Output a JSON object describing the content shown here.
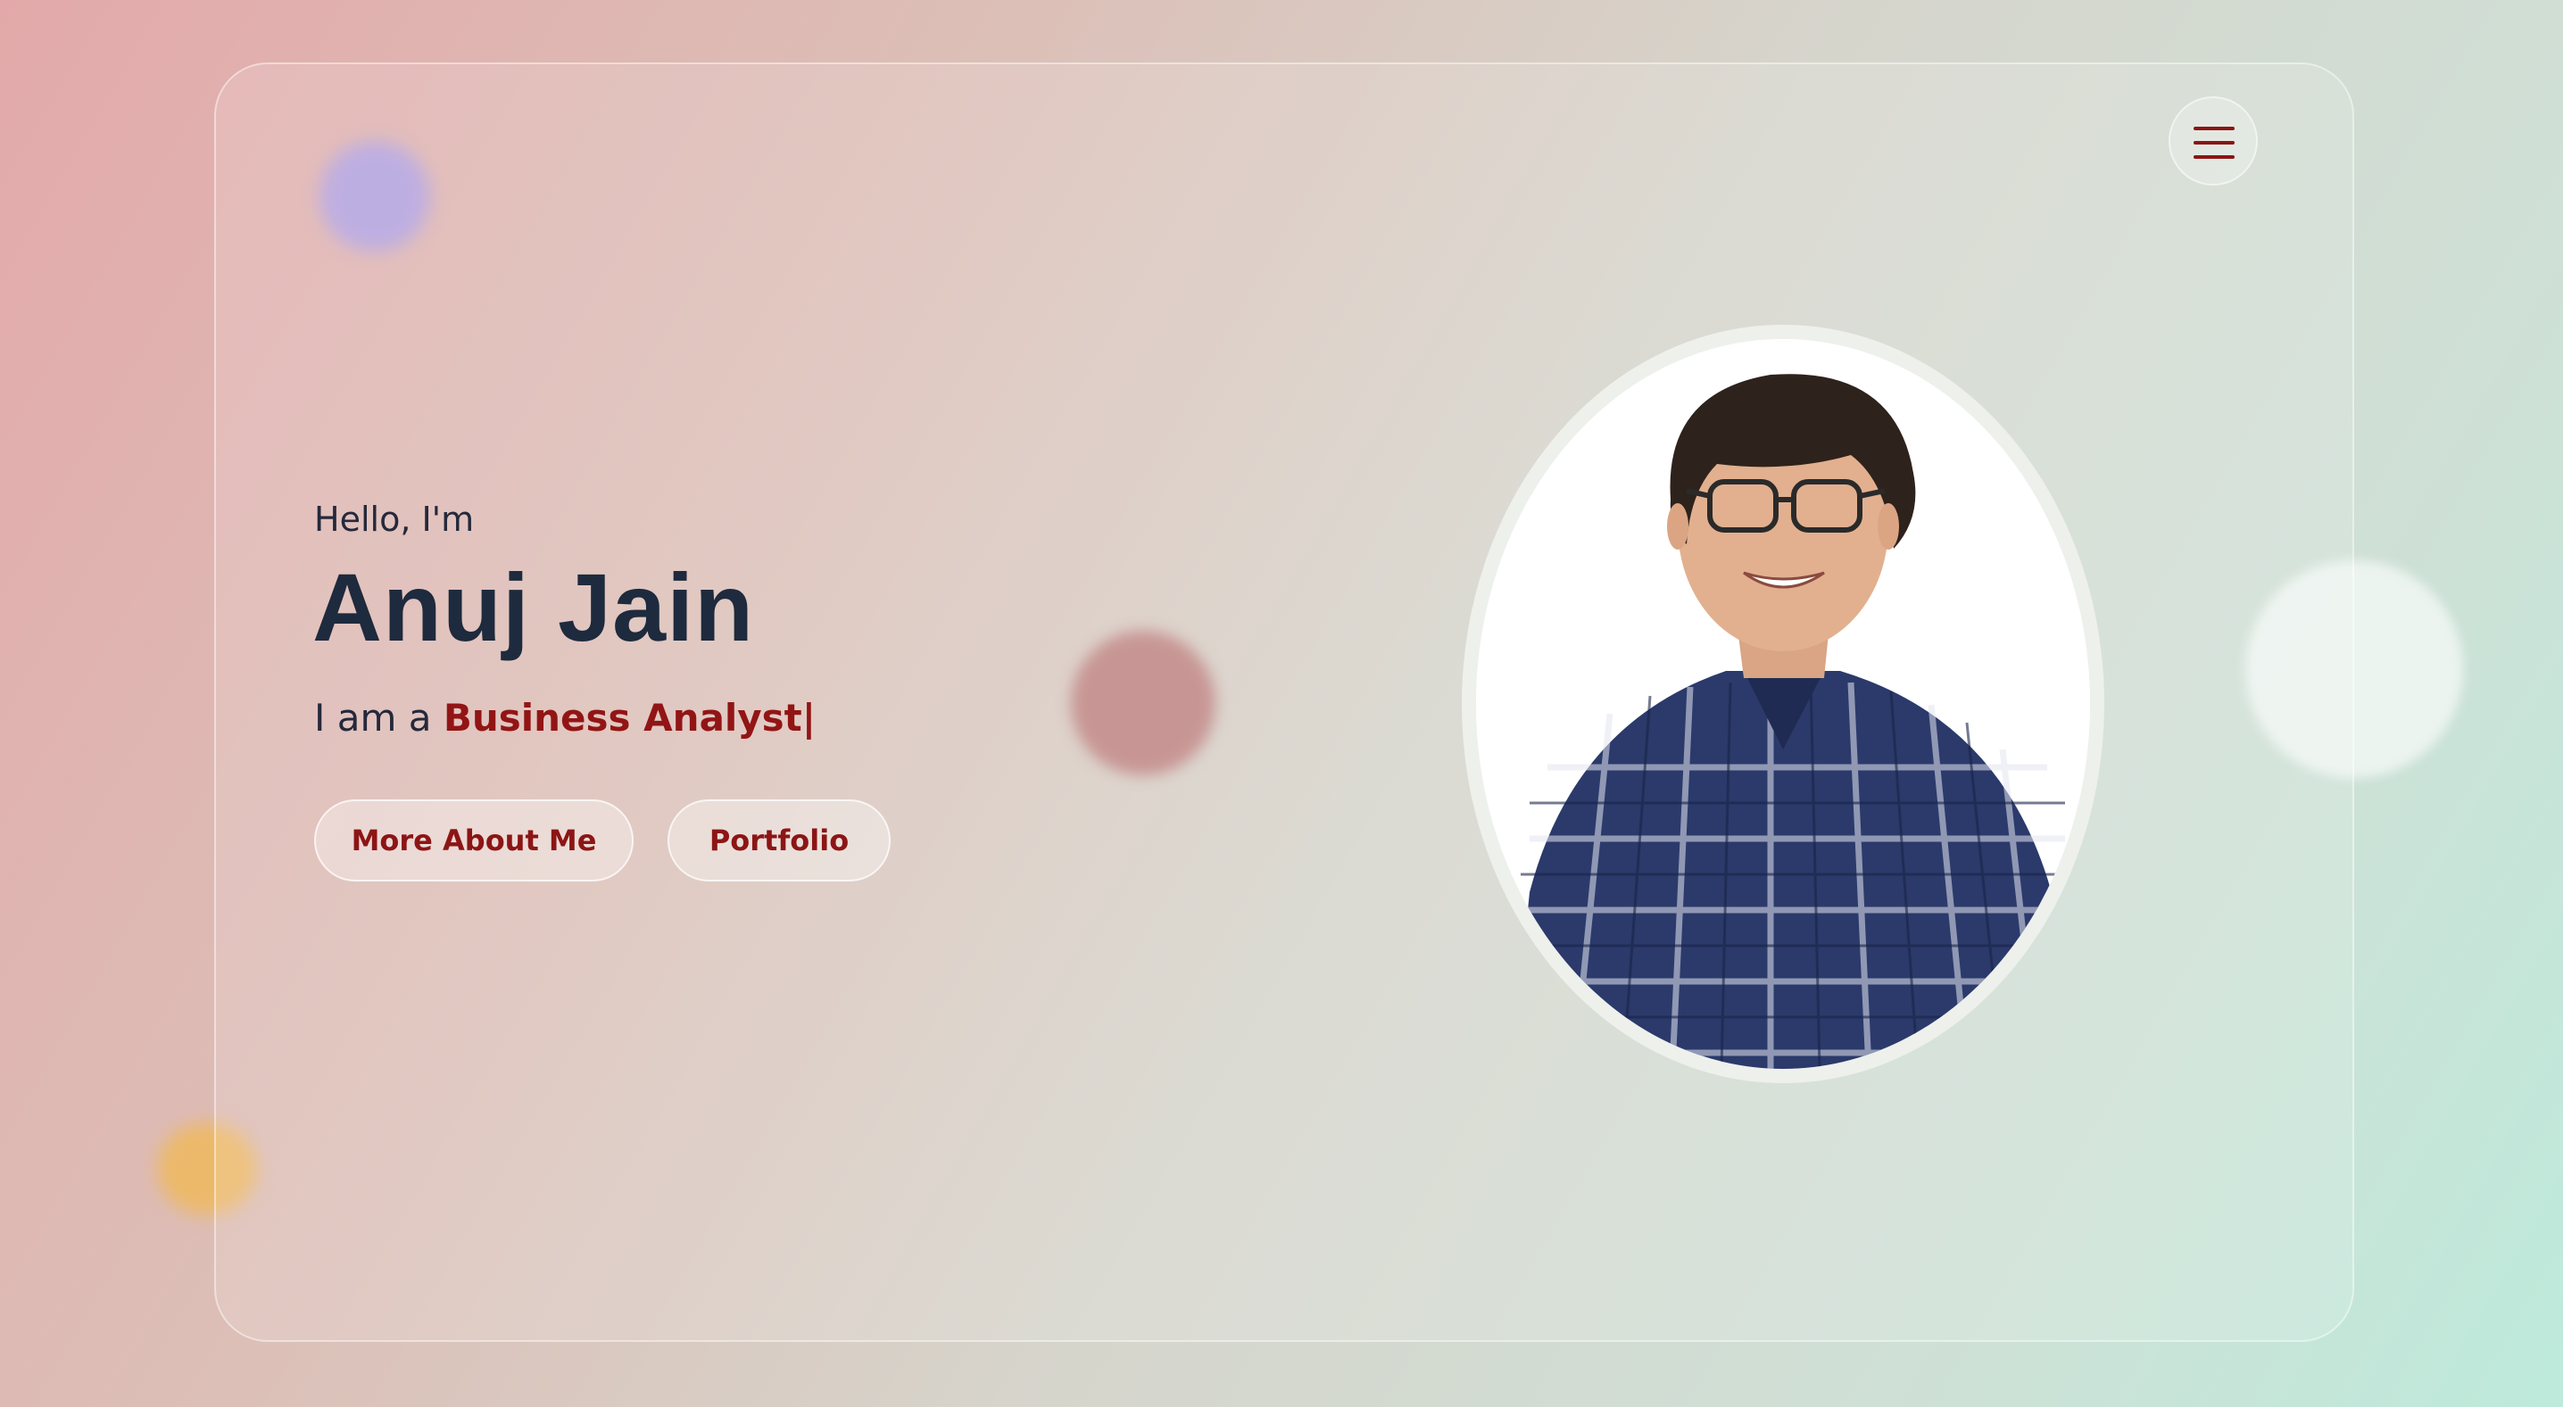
{
  "hero": {
    "greeting": "Hello, I'm",
    "name": "Anuj Jain",
    "role_prefix": "I am a",
    "role": "Business Analyst",
    "cursor": "|"
  },
  "buttons": {
    "more_about": "More About Me",
    "portfolio": "Portfolio"
  },
  "menu": {
    "icon": "hamburger-menu-icon"
  },
  "portrait": {
    "alt": "Portrait photo of Anuj Jain"
  },
  "colors": {
    "accent": "#921515",
    "heading": "#1e2a3d"
  }
}
